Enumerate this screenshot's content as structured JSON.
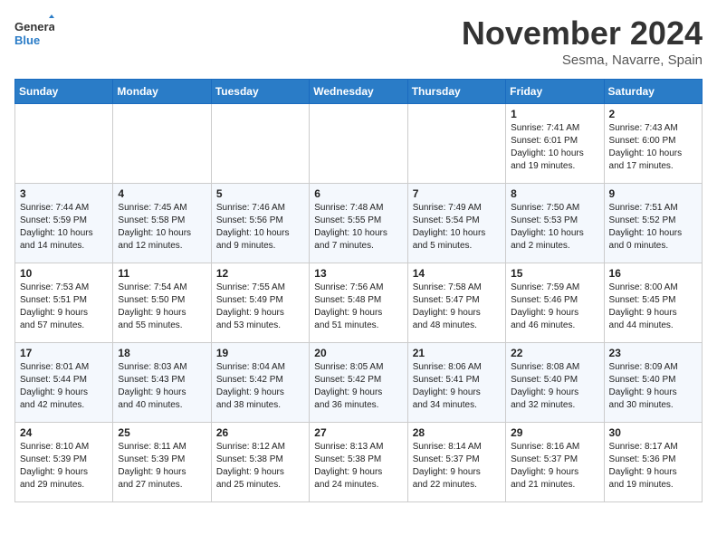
{
  "header": {
    "logo_line1": "General",
    "logo_line2": "Blue",
    "month": "November 2024",
    "location": "Sesma, Navarre, Spain"
  },
  "weekdays": [
    "Sunday",
    "Monday",
    "Tuesday",
    "Wednesday",
    "Thursday",
    "Friday",
    "Saturday"
  ],
  "weeks": [
    [
      {
        "day": "",
        "text": ""
      },
      {
        "day": "",
        "text": ""
      },
      {
        "day": "",
        "text": ""
      },
      {
        "day": "",
        "text": ""
      },
      {
        "day": "",
        "text": ""
      },
      {
        "day": "1",
        "text": "Sunrise: 7:41 AM\nSunset: 6:01 PM\nDaylight: 10 hours\nand 19 minutes."
      },
      {
        "day": "2",
        "text": "Sunrise: 7:43 AM\nSunset: 6:00 PM\nDaylight: 10 hours\nand 17 minutes."
      }
    ],
    [
      {
        "day": "3",
        "text": "Sunrise: 7:44 AM\nSunset: 5:59 PM\nDaylight: 10 hours\nand 14 minutes."
      },
      {
        "day": "4",
        "text": "Sunrise: 7:45 AM\nSunset: 5:58 PM\nDaylight: 10 hours\nand 12 minutes."
      },
      {
        "day": "5",
        "text": "Sunrise: 7:46 AM\nSunset: 5:56 PM\nDaylight: 10 hours\nand 9 minutes."
      },
      {
        "day": "6",
        "text": "Sunrise: 7:48 AM\nSunset: 5:55 PM\nDaylight: 10 hours\nand 7 minutes."
      },
      {
        "day": "7",
        "text": "Sunrise: 7:49 AM\nSunset: 5:54 PM\nDaylight: 10 hours\nand 5 minutes."
      },
      {
        "day": "8",
        "text": "Sunrise: 7:50 AM\nSunset: 5:53 PM\nDaylight: 10 hours\nand 2 minutes."
      },
      {
        "day": "9",
        "text": "Sunrise: 7:51 AM\nSunset: 5:52 PM\nDaylight: 10 hours\nand 0 minutes."
      }
    ],
    [
      {
        "day": "10",
        "text": "Sunrise: 7:53 AM\nSunset: 5:51 PM\nDaylight: 9 hours\nand 57 minutes."
      },
      {
        "day": "11",
        "text": "Sunrise: 7:54 AM\nSunset: 5:50 PM\nDaylight: 9 hours\nand 55 minutes."
      },
      {
        "day": "12",
        "text": "Sunrise: 7:55 AM\nSunset: 5:49 PM\nDaylight: 9 hours\nand 53 minutes."
      },
      {
        "day": "13",
        "text": "Sunrise: 7:56 AM\nSunset: 5:48 PM\nDaylight: 9 hours\nand 51 minutes."
      },
      {
        "day": "14",
        "text": "Sunrise: 7:58 AM\nSunset: 5:47 PM\nDaylight: 9 hours\nand 48 minutes."
      },
      {
        "day": "15",
        "text": "Sunrise: 7:59 AM\nSunset: 5:46 PM\nDaylight: 9 hours\nand 46 minutes."
      },
      {
        "day": "16",
        "text": "Sunrise: 8:00 AM\nSunset: 5:45 PM\nDaylight: 9 hours\nand 44 minutes."
      }
    ],
    [
      {
        "day": "17",
        "text": "Sunrise: 8:01 AM\nSunset: 5:44 PM\nDaylight: 9 hours\nand 42 minutes."
      },
      {
        "day": "18",
        "text": "Sunrise: 8:03 AM\nSunset: 5:43 PM\nDaylight: 9 hours\nand 40 minutes."
      },
      {
        "day": "19",
        "text": "Sunrise: 8:04 AM\nSunset: 5:42 PM\nDaylight: 9 hours\nand 38 minutes."
      },
      {
        "day": "20",
        "text": "Sunrise: 8:05 AM\nSunset: 5:42 PM\nDaylight: 9 hours\nand 36 minutes."
      },
      {
        "day": "21",
        "text": "Sunrise: 8:06 AM\nSunset: 5:41 PM\nDaylight: 9 hours\nand 34 minutes."
      },
      {
        "day": "22",
        "text": "Sunrise: 8:08 AM\nSunset: 5:40 PM\nDaylight: 9 hours\nand 32 minutes."
      },
      {
        "day": "23",
        "text": "Sunrise: 8:09 AM\nSunset: 5:40 PM\nDaylight: 9 hours\nand 30 minutes."
      }
    ],
    [
      {
        "day": "24",
        "text": "Sunrise: 8:10 AM\nSunset: 5:39 PM\nDaylight: 9 hours\nand 29 minutes."
      },
      {
        "day": "25",
        "text": "Sunrise: 8:11 AM\nSunset: 5:39 PM\nDaylight: 9 hours\nand 27 minutes."
      },
      {
        "day": "26",
        "text": "Sunrise: 8:12 AM\nSunset: 5:38 PM\nDaylight: 9 hours\nand 25 minutes."
      },
      {
        "day": "27",
        "text": "Sunrise: 8:13 AM\nSunset: 5:38 PM\nDaylight: 9 hours\nand 24 minutes."
      },
      {
        "day": "28",
        "text": "Sunrise: 8:14 AM\nSunset: 5:37 PM\nDaylight: 9 hours\nand 22 minutes."
      },
      {
        "day": "29",
        "text": "Sunrise: 8:16 AM\nSunset: 5:37 PM\nDaylight: 9 hours\nand 21 minutes."
      },
      {
        "day": "30",
        "text": "Sunrise: 8:17 AM\nSunset: 5:36 PM\nDaylight: 9 hours\nand 19 minutes."
      }
    ]
  ]
}
